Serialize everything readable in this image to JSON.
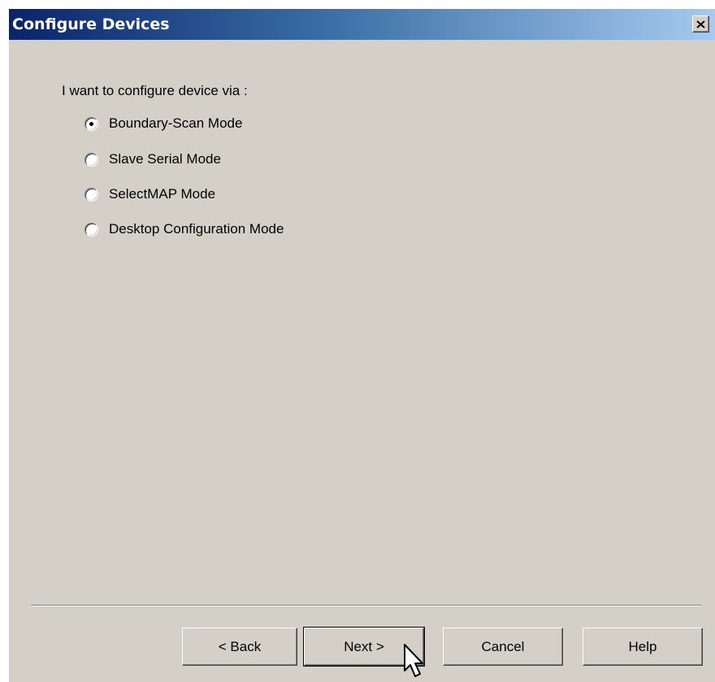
{
  "window": {
    "title": "Configure Devices",
    "close_icon": "close-icon",
    "title_gradient": [
      "#0a246a",
      "#a6caf0"
    ],
    "background": "#d4d0c8"
  },
  "prompt": "I want to configure device via :",
  "modes": [
    {
      "label": "Boundary-Scan Mode",
      "selected": true
    },
    {
      "label": "Slave Serial Mode",
      "selected": false
    },
    {
      "label": "SelectMAP Mode",
      "selected": false
    },
    {
      "label": "Desktop Configuration Mode",
      "selected": false
    }
  ],
  "buttons": {
    "back": "< Back",
    "next": "Next >",
    "cancel": "Cancel",
    "help": "Help"
  },
  "cursor_icon": "arrow-cursor-icon"
}
